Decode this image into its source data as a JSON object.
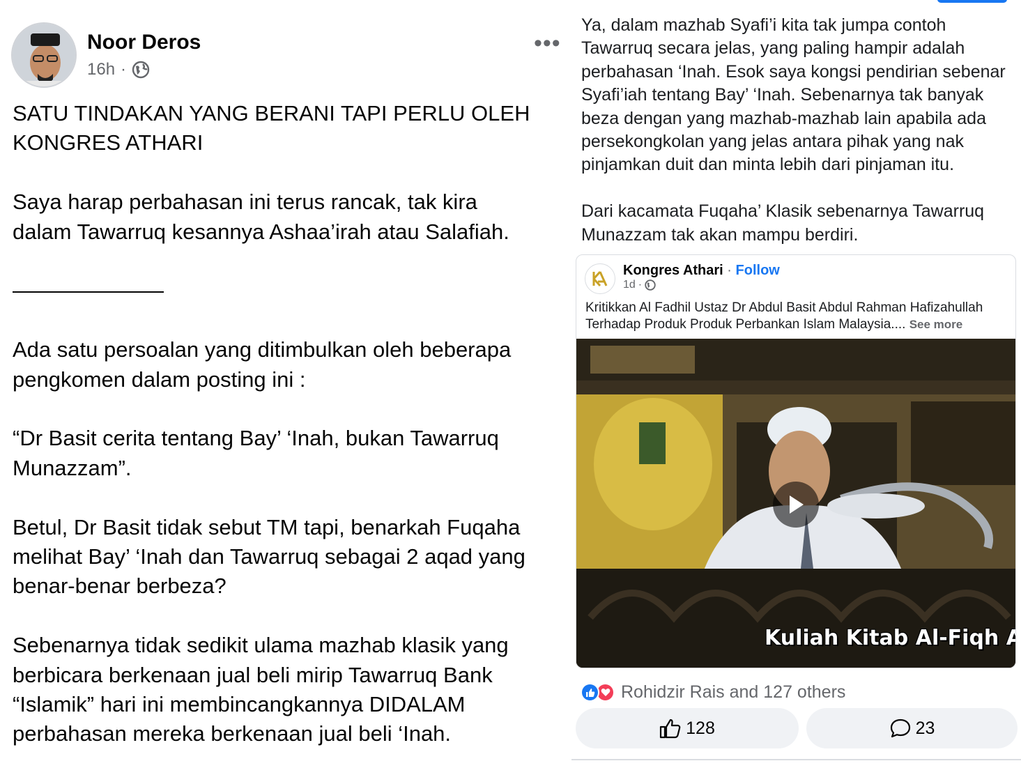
{
  "post": {
    "author": "Noor Deros",
    "time": "16h",
    "separator": "·",
    "more_glyph": "•••",
    "paragraphs": [
      "SATU TINDAKAN YANG BERANI TAPI PERLU OLEH\nKONGRES ATHARI",
      "Saya harap perbahasan ini terus rancak, tak kira\ndalam Tawarruq kesannya Ashaa’irah atau Salafiah.",
      "———————",
      "Ada satu persoalan yang ditimbulkan oleh beberapa\npengkomen dalam posting ini :",
      "“Dr Basit cerita tentang Bay’ ‘Inah, bukan Tawarruq\nMunazzam”.",
      "Betul, Dr Basit tidak sebut TM tapi, benarkah Fuqaha\nmelihat Bay’ ‘Inah dan Tawarruq sebagai 2 aqad yang\nbenar-benar berbeza?",
      "Sebenarnya tidak sedikit ulama mazhab klasik yang\nberbicara berkenaan jual beli mirip Tawarruq Bank\n“Islamik” hari ini membincangkannya DIDALAM\nperbahasan mereka berkenaan jual beli ‘Inah."
    ]
  },
  "continuation": {
    "paragraphs": [
      "Ya, dalam mazhab Syafi’i kita tak jumpa contoh\nTawarruq secara jelas, yang paling hampir adalah\nperbahasan ‘Inah. Esok saya kongsi pendirian sebenar\nSyafi’iah tentang Bay’ ‘Inah. Sebenarnya tak banyak\nbeza dengan yang mazhab-mazhab lain apabila ada\npersekongkolan yang jelas antara pihak yang nak\npinjamkan duit dan minta lebih dari pinjaman itu.",
      "Dari kacamata Fuqaha’ Klasik sebenarnya Tawarruq\nMunazzam tak akan mampu berdiri."
    ]
  },
  "shared_post": {
    "page_name": "Kongres Athari",
    "dot": " · ",
    "follow_label": "Follow",
    "time": "1d",
    "separator": "·",
    "text": "Kritikkan Al Fadhil Ustaz Dr Abdul Basit Abdul Rahman Hafizahullah\nTerhadap Produk Produk Perbankan Islam Malaysia....",
    "see_more": "See more",
    "video_caption": "Kuliah Kitab Al-Fiqh Al-"
  },
  "reactions": {
    "summary": "Rohidzir Rais and 127 others",
    "like_count": "128",
    "comment_count": "23"
  },
  "colors": {
    "accent": "#1877f2",
    "love": "#f33e58",
    "muted": "#65676b",
    "button_bg": "#f0f2f5"
  },
  "icons": [
    "globe-icon",
    "more-icon",
    "play-icon",
    "like-reaction-icon",
    "love-reaction-icon",
    "thumbs-up-icon",
    "comment-icon"
  ]
}
